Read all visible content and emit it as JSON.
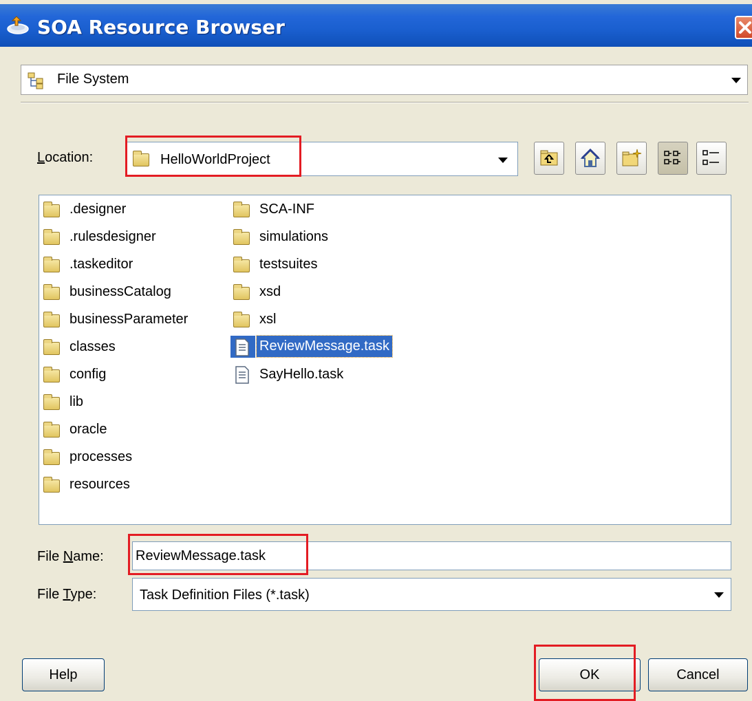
{
  "window": {
    "title": "SOA Resource Browser"
  },
  "source": {
    "selected": "File System"
  },
  "location": {
    "label_pre": "",
    "label_mnemonic": "L",
    "label_post": "ocation:",
    "value": "HelloWorldProject"
  },
  "toolbar": {
    "up": "up-folder-icon",
    "home": "home-icon",
    "new_folder": "new-folder-icon",
    "list_view": "list-view-icon",
    "details_view": "details-view-icon"
  },
  "files": {
    "col1": [
      ".designer",
      ".rulesdesigner",
      ".taskeditor",
      "businessCatalog",
      "businessParameter",
      "classes",
      "config",
      "lib",
      "oracle",
      "processes",
      "resources"
    ],
    "col2_folders": [
      "SCA-INF",
      "simulations",
      "testsuites",
      "xsd",
      "xsl"
    ],
    "col2_files": [
      "ReviewMessage.task",
      "SayHello.task"
    ]
  },
  "filename": {
    "label_pre": "File ",
    "label_mnemonic": "N",
    "label_post": "ame:",
    "value": "ReviewMessage.task"
  },
  "filetype": {
    "label_pre": "File ",
    "label_mnemonic": "T",
    "label_post": "ype:",
    "value": "Task Definition Files (*.task)"
  },
  "buttons": {
    "help": "Help",
    "ok": "OK",
    "cancel": "Cancel"
  },
  "colors": {
    "titlebar": "#1a5fcf",
    "highlight": "#e31c23",
    "selection": "#316ac5"
  }
}
